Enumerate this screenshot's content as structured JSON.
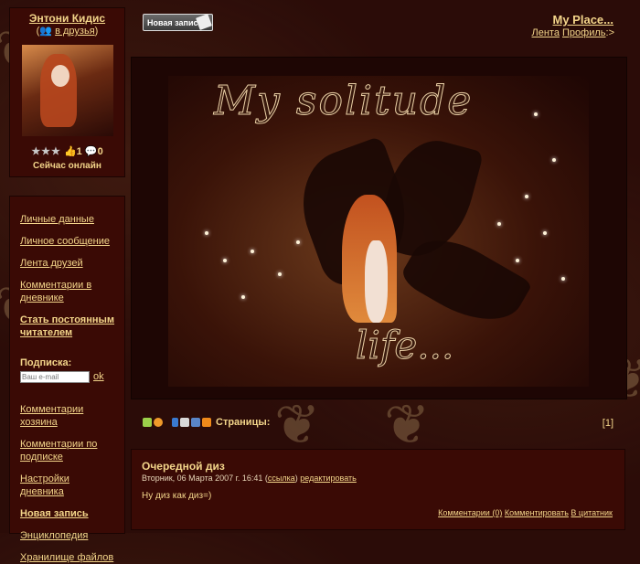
{
  "profile": {
    "username": "Энтони Кидис",
    "friend_prefix": "(",
    "friend_link": "в друзья",
    "friend_suffix": ")",
    "ratings": "★★★",
    "count_a": "1",
    "count_b": "0",
    "status": "Сейчас онлайн"
  },
  "top": {
    "new_entry_button": "Новая запись",
    "site_title": "My Place...",
    "link_feed": "Лента",
    "link_profile": "Профиль",
    "profile_suffix": ":>"
  },
  "banner": {
    "title_text": "My solitude",
    "life_text": "life..."
  },
  "menu": {
    "items_top": [
      "Личные данные",
      "Личное сообщение",
      "Лента друзей",
      "Комментарии в дневнике",
      "Стать постоянным читателем"
    ],
    "subscribe_label": "Подписка:",
    "email_placeholder": "Ваш e-mail",
    "ok_label": "ok",
    "items_bottom": [
      "Комментарии хозяина",
      "Комментарии по подписке",
      "Настройки дневника",
      "Новая запись",
      "Энциклопедия",
      "Хранилище файлов"
    ]
  },
  "toolbar": {
    "pages_label": "Страницы:",
    "page_number": "[1]"
  },
  "post": {
    "title": "Очередной диз",
    "date": "Вторник, 06 Марта 2007 г. 16:41 (",
    "link_label": "ссылка",
    "date_close": ")",
    "edit_label": "редактировать",
    "body": "Ну диз как диз=)",
    "comments_label": "Комментарии (0)",
    "comment_label": "Комментировать",
    "quote_label": "В цитатник"
  }
}
